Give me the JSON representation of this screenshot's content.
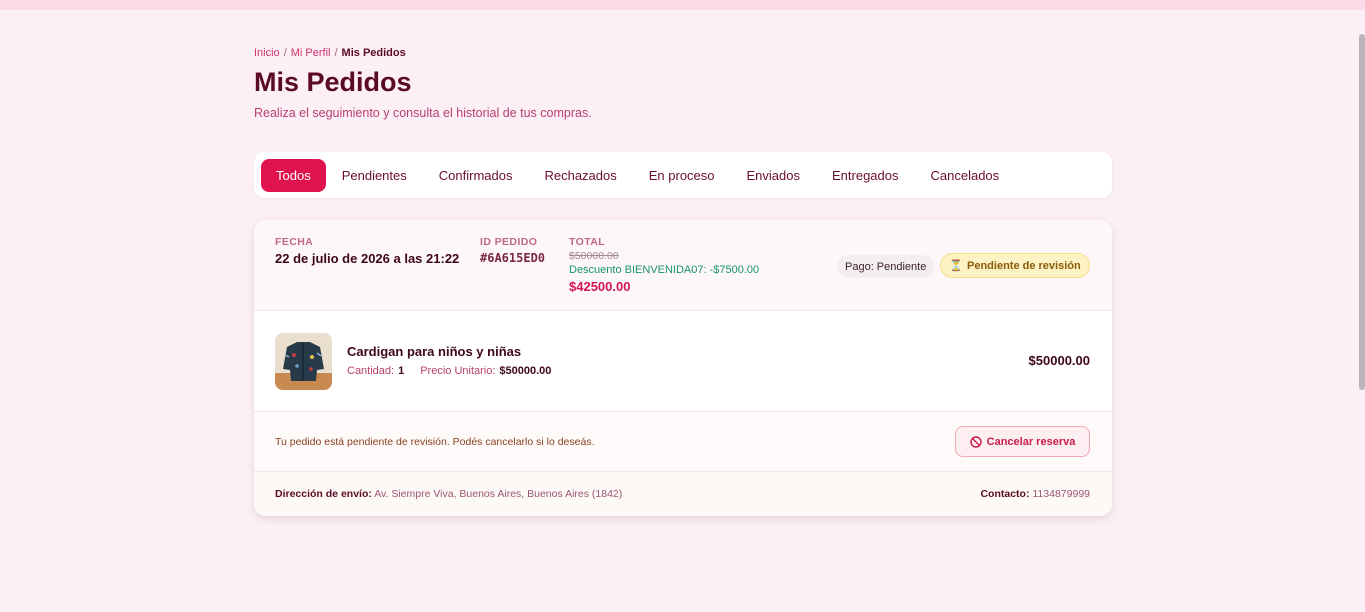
{
  "breadcrumb": {
    "items": [
      "Inicio",
      "Mi Perfil"
    ],
    "separator": "/",
    "current": "Mis Pedidos"
  },
  "header": {
    "title": "Mis Pedidos",
    "subtitle": "Realiza el seguimiento y consulta el historial de tus compras."
  },
  "tabs": [
    "Todos",
    "Pendientes",
    "Confirmados",
    "Rechazados",
    "En proceso",
    "Enviados",
    "Entregados",
    "Cancelados"
  ],
  "active_tab": "Todos",
  "order": {
    "date_label": "FECHA",
    "date_value": "22 de julio de 2026 a las 21:22",
    "id_label": "ID PEDIDO",
    "id_value": "#6A615ED0",
    "total_label": "TOTAL",
    "original_total": "$50000.00",
    "discount_text": "Descuento BIENVENIDA07: -$7500.00",
    "final_total": "$42500.00",
    "payment_badge": "Pago: Pendiente",
    "status_icon": "hourglass-icon",
    "status_badge": "Pendiente de revisión",
    "item": {
      "name": "Cardigan para niños y niñas",
      "quantity_label": "Cantidad:",
      "quantity_value": "1",
      "unit_price_label": "Precio Unitario:",
      "unit_price_value": "$50000.00",
      "line_total": "$50000.00"
    },
    "notice": "Tu pedido está pendiente de revisión. Podés cancelarlo si lo deseás.",
    "cancel_button": "Cancelar reserva",
    "address_label": "Dirección de envío:",
    "address_value": "Av. Siempre Viva, Buenos Aires, Buenos Aires (1842)",
    "contact_label": "Contacto:",
    "contact_value": "1134879999"
  },
  "colors": {
    "accent": "#e0134f",
    "background": "#fcf0f6",
    "dark_text": "#5a0a24",
    "discount": "#17946a",
    "status_bg": "#fdf2c3"
  }
}
